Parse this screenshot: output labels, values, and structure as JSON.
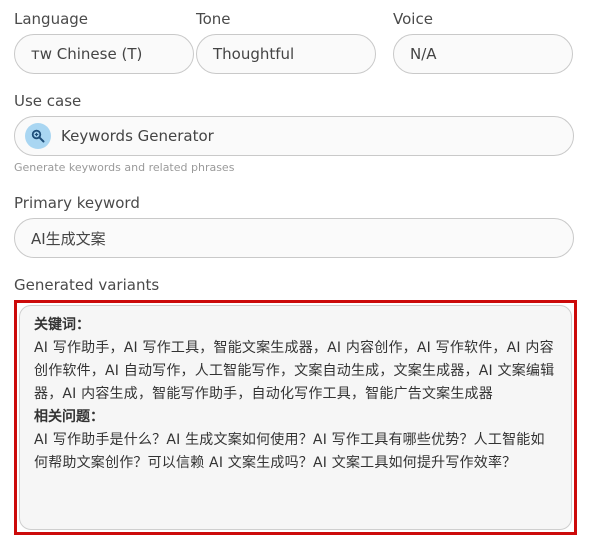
{
  "language": {
    "label": "Language",
    "value": "ᴛw Chinese (T)"
  },
  "tone": {
    "label": "Tone",
    "value": "Thoughtful"
  },
  "voice": {
    "label": "Voice",
    "value": "N/A"
  },
  "use_case": {
    "label": "Use case",
    "value": "Keywords Generator",
    "hint": "Generate keywords and related phrases",
    "icon": "magnifier-icon"
  },
  "primary_keyword": {
    "label": "Primary keyword",
    "value": "AI生成文案"
  },
  "generated_variants": {
    "label": "Generated variants",
    "keywords_heading": "关键词：",
    "keywords_text": "AI 写作助手，AI 写作工具，智能文案生成器，AI 内容创作，AI 写作软件，AI 内容创作软件，AI 自动写作，人工智能写作，文案自动生成，文案生成器，AI 文案编辑器，AI 内容生成，智能写作助手，自动化写作工具，智能广告文案生成器",
    "questions_heading": "相关问题：",
    "questions_text": "AI 写作助手是什么？AI 生成文案如何使用？AI 写作工具有哪些优势？人工智能如何帮助文案创作？可以信赖 AI 文案生成吗？AI 文案工具如何提升写作效率？"
  },
  "colors": {
    "highlight_border": "#cc0a0a",
    "icon_bg": "#a9d6f2"
  }
}
